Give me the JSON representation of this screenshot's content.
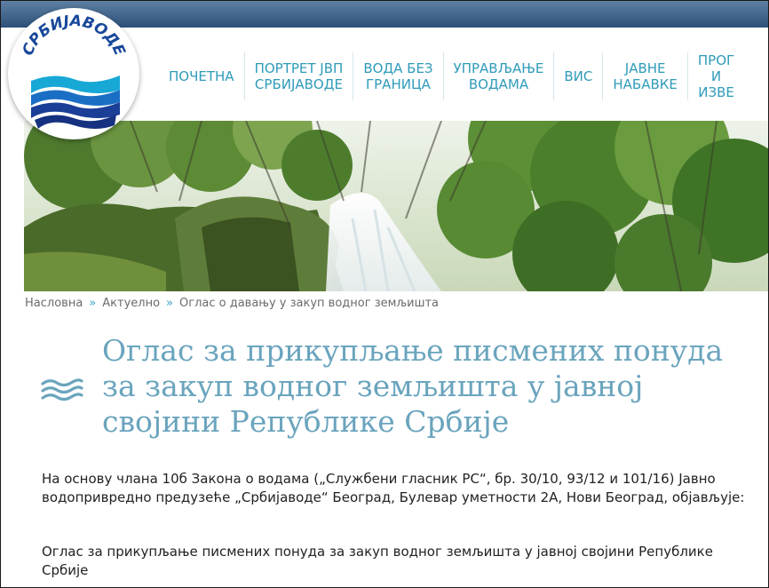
{
  "brand": {
    "logo_text": "СРБИЈАВОДЕ",
    "logo_icon": "waves-icon"
  },
  "nav": {
    "items": [
      {
        "label": "ПОЧЕТНА"
      },
      {
        "label": "ПОРТРЕТ ЈВП\nСРБИЈАВОДЕ"
      },
      {
        "label": "ВОДА БЕЗ\nГРАНИЦА"
      },
      {
        "label": "УПРАВЉАЊЕ\nВОДАМА"
      },
      {
        "label": "ВИС"
      },
      {
        "label": "ЈАВНЕ\nНАБАВКЕ"
      },
      {
        "label": "ПРОГ\nИ\nИЗВЕ"
      }
    ]
  },
  "breadcrumb": {
    "items": [
      "Насловна",
      "Актуелно",
      "Оглас о давању у закуп водног земљишта"
    ],
    "separator": "»"
  },
  "article": {
    "title": "Оглас за прикупљање писмених понуда за закуп водног земљишта у јавној својини Републике Србије",
    "icon": "waves-icon",
    "paragraphs": [
      "На основу члана 10б Закона о водама („Службени гласник РС“, бр. 30/10, 93/12 и 101/16) Јавно водопривредно предузеће „Србијаводе“ Београд, Булевар уметности 2А, Нови Београд, објављује:",
      "Оглас за прикупљање писмених понуда за закуп водног земљишта у јавној својини Републике Србије"
    ]
  },
  "colors": {
    "accent": "#2f9bb9",
    "title": "#6aa4bd",
    "topbar": "#2d5179",
    "logo_text": "#17489a"
  }
}
